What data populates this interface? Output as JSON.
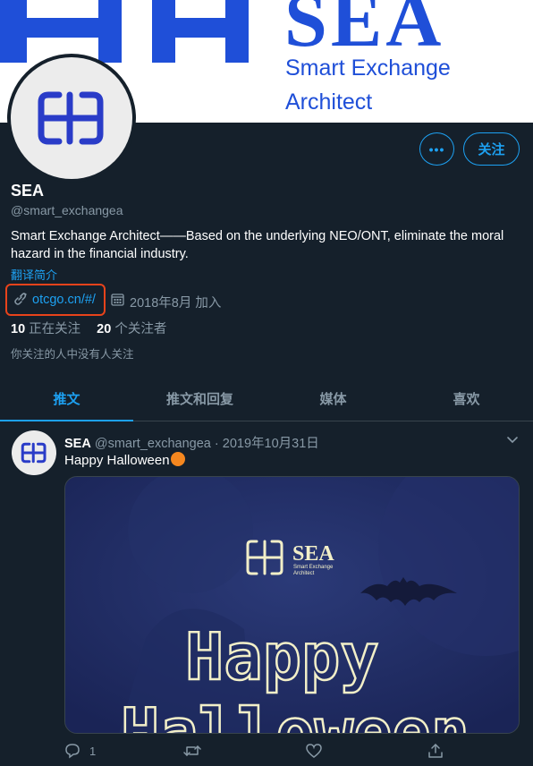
{
  "banner": {
    "brand": "SEA",
    "tagline_line1": "Smart Exchange",
    "tagline_line2": "Architect"
  },
  "profile": {
    "more_label": "•••",
    "follow_label": "关注",
    "name": "SEA",
    "handle": "@smart_exchangea",
    "bio": "Smart Exchange Architect——Based on the underlying NEO/ONT, eliminate the moral hazard in the financial industry.",
    "translate_label": "翻译简介",
    "website": "otcgo.cn/#/",
    "joined": "2018年8月 加入",
    "following_count": "10",
    "following_label": "正在关注",
    "followers_count": "20",
    "followers_label": "个关注者",
    "mutual_note": "你关注的人中没有人关注"
  },
  "tabs": [
    {
      "label": "推文",
      "active": true
    },
    {
      "label": "推文和回复",
      "active": false
    },
    {
      "label": "媒体",
      "active": false
    },
    {
      "label": "喜欢",
      "active": false
    }
  ],
  "tweet": {
    "name": "SEA",
    "handle": "@smart_exchangea",
    "separator": "·",
    "date": "2019年10月31日",
    "text": "Happy Halloween",
    "image": {
      "brand": "SEA",
      "sub1": "Smart Exchange",
      "sub2": "Architect",
      "line1": "Happy",
      "line2": "Halloween"
    },
    "reply_count": "1"
  },
  "colors": {
    "background": "#15202b",
    "accent": "#1da1f2",
    "muted": "#8899a6",
    "brand_blue": "#1f4fd8",
    "highlight_box": "#e8431b"
  },
  "icons": [
    "link-icon",
    "calendar-icon",
    "chevron-down-icon",
    "reply-icon",
    "retweet-icon",
    "like-icon",
    "share-icon",
    "pumpkin-emoji"
  ]
}
